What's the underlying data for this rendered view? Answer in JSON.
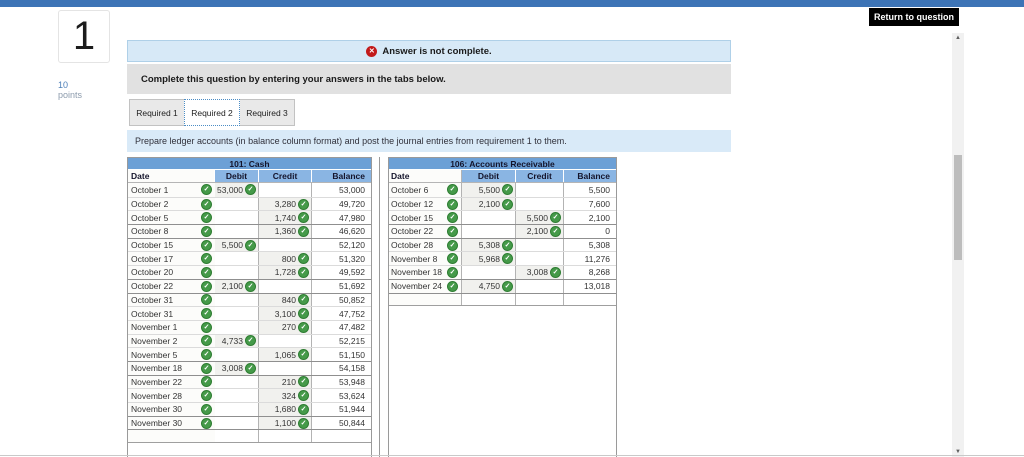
{
  "colors": {
    "top_bar": "#3d74b6",
    "banner_blue_bg": "#d7e9f7",
    "banner_blue_border": "#afd0e8",
    "banner_gray_bg": "#e1e1e1",
    "hint_bg": "#d9eaf8",
    "table_title_bg": "#6ca0d6",
    "table_head_bg": "#8ab5e3",
    "filled_cell_bg": "#f1f1ee",
    "check_green": "#459a49",
    "error_red": "#c21a1a"
  },
  "page": {
    "question_number": "1",
    "points_value": "10",
    "points_label": "points",
    "return_button": "Return to question"
  },
  "banners": {
    "status": "Answer is not complete.",
    "instruction": "Complete this question by entering your answers in the tabs below.",
    "tab_hint": "Prepare ledger accounts (in balance column format) and post the journal entries from requirement 1 to them."
  },
  "tabs": [
    {
      "label": "Required 1",
      "active": false
    },
    {
      "label": "Required 2",
      "active": true
    },
    {
      "label": "Required 3",
      "active": false
    }
  ],
  "ledgers": [
    {
      "title": "101: Cash",
      "columns": [
        "Date",
        "Debit",
        "Credit",
        "Balance"
      ],
      "date_border": false,
      "rows": [
        {
          "date": "October 1",
          "debit": "53,000",
          "credit": "",
          "balance": "53,000",
          "group": false
        },
        {
          "date": "October 2",
          "debit": "",
          "credit": "3,280",
          "balance": "49,720",
          "group": false
        },
        {
          "date": "October 5",
          "debit": "",
          "credit": "1,740",
          "balance": "47,980",
          "group": false
        },
        {
          "date": "October 8",
          "debit": "",
          "credit": "1,360",
          "balance": "46,620",
          "group": true
        },
        {
          "date": "October 15",
          "debit": "5,500",
          "credit": "",
          "balance": "52,120",
          "group": true
        },
        {
          "date": "October 17",
          "debit": "",
          "credit": "800",
          "balance": "51,320",
          "group": false
        },
        {
          "date": "October 20",
          "debit": "",
          "credit": "1,728",
          "balance": "49,592",
          "group": false
        },
        {
          "date": "October 22",
          "debit": "2,100",
          "credit": "",
          "balance": "51,692",
          "group": true
        },
        {
          "date": "October 31",
          "debit": "",
          "credit": "840",
          "balance": "50,852",
          "group": true
        },
        {
          "date": "October 31",
          "debit": "",
          "credit": "3,100",
          "balance": "47,752",
          "group": false
        },
        {
          "date": "November 1",
          "debit": "",
          "credit": "270",
          "balance": "47,482",
          "group": false
        },
        {
          "date": "November 2",
          "debit": "4,733",
          "credit": "",
          "balance": "52,215",
          "group": false
        },
        {
          "date": "November 5",
          "debit": "",
          "credit": "1,065",
          "balance": "51,150",
          "group": false
        },
        {
          "date": "November 18",
          "debit": "3,008",
          "credit": "",
          "balance": "54,158",
          "group": true
        },
        {
          "date": "November 22",
          "debit": "",
          "credit": "210",
          "balance": "53,948",
          "group": true
        },
        {
          "date": "November 28",
          "debit": "",
          "credit": "324",
          "balance": "53,624",
          "group": false
        },
        {
          "date": "November 30",
          "debit": "",
          "credit": "1,680",
          "balance": "51,944",
          "group": false
        },
        {
          "date": "November 30",
          "debit": "",
          "credit": "1,100",
          "balance": "50,844",
          "group": true
        },
        {
          "date": "",
          "debit": "",
          "credit": "",
          "balance": "",
          "group": true,
          "empty": true
        }
      ]
    },
    {
      "title": "106: Accounts Receivable",
      "columns": [
        "Date",
        "Debit",
        "Credit",
        "Balance"
      ],
      "date_border": true,
      "rows": [
        {
          "date": "October 6",
          "debit": "5,500",
          "credit": "",
          "balance": "5,500",
          "group": false
        },
        {
          "date": "October 12",
          "debit": "2,100",
          "credit": "",
          "balance": "7,600",
          "group": false
        },
        {
          "date": "October 15",
          "debit": "",
          "credit": "5,500",
          "balance": "2,100",
          "group": false
        },
        {
          "date": "October 22",
          "debit": "",
          "credit": "2,100",
          "balance": "0",
          "group": true
        },
        {
          "date": "October 28",
          "debit": "5,308",
          "credit": "",
          "balance": "5,308",
          "group": true
        },
        {
          "date": "November 8",
          "debit": "5,968",
          "credit": "",
          "balance": "11,276",
          "group": false
        },
        {
          "date": "November 18",
          "debit": "",
          "credit": "3,008",
          "balance": "8,268",
          "group": false
        },
        {
          "date": "November 24",
          "debit": "4,750",
          "credit": "",
          "balance": "13,018",
          "group": true
        },
        {
          "date": "",
          "debit": "",
          "credit": "",
          "balance": "",
          "group": true,
          "empty": true
        }
      ]
    }
  ],
  "scrollbar": {
    "up_glyph": "▲",
    "down_glyph": "▼"
  },
  "icons": {
    "check_glyph": "✓",
    "error_glyph": "✕"
  }
}
